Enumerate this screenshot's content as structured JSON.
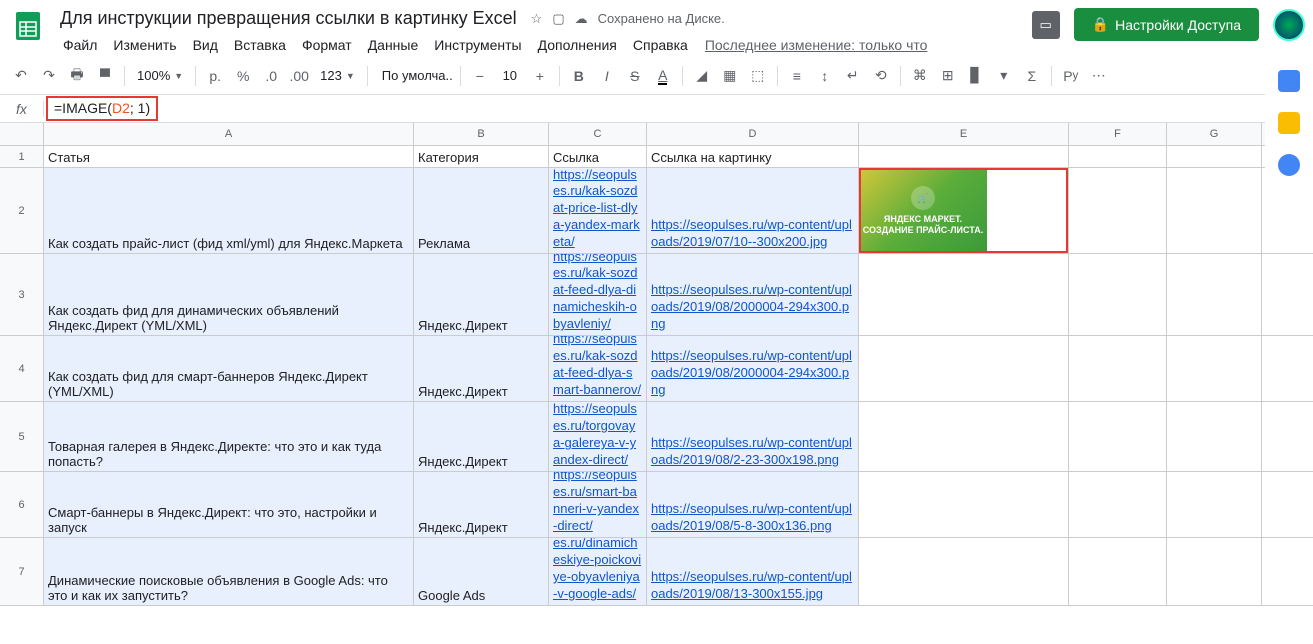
{
  "doc_title": "Для инструкции превращения ссылки в картинку Excel",
  "drive_status": "Сохранено на Диске.",
  "menus": [
    "Файл",
    "Изменить",
    "Вид",
    "Вставка",
    "Формат",
    "Данные",
    "Инструменты",
    "Дополнения",
    "Справка"
  ],
  "last_edit": "Последнее изменение: только что",
  "share_btn": "Настройки Доступа",
  "toolbar": {
    "zoom": "100%",
    "currency": "р.",
    "percent": "%",
    "dec1": ".0",
    "dec2": ".00",
    "fmt": "123",
    "font": "По умолча...",
    "size": "10"
  },
  "formula": {
    "prefix": "=IMAGE(",
    "ref": "D2",
    "suffix": "; 1)"
  },
  "cols": [
    "A",
    "B",
    "C",
    "D",
    "E",
    "F",
    "G"
  ],
  "headers": {
    "a": "Статья",
    "b": "Категория",
    "c": "Ссылка",
    "d": "Ссылка на картинку"
  },
  "rows": [
    {
      "n": "2",
      "a": "Как создать прайс-лист (фид xml/yml) для Яндекс.Маркета",
      "b": "Реклама",
      "c": "https://seopulses.ru/kak-sozdat-price-list-dlya-yandex-marketa/",
      "d": "https://seopulses.ru/wp-content/uploads/2019/07/10--300x200.jpg"
    },
    {
      "n": "3",
      "a": "Как создать фид для динамических объявлений Яндекс.Директ (YML/XML)",
      "b": "Яндекс.Директ",
      "c": "https://seopulses.ru/kak-sozdat-feed-dlya-dinamicheskih-obyavleniy/",
      "d": "https://seopulses.ru/wp-content/uploads/2019/08/2000004-294x300.png"
    },
    {
      "n": "4",
      "a": "Как создать фид для смарт-баннеров Яндекс.Директ (YML/XML)",
      "b": "Яндекс.Директ",
      "c": "https://seopulses.ru/kak-sozdat-feed-dlya-smart-bannerov/",
      "d": "https://seopulses.ru/wp-content/uploads/2019/08/2000004-294x300.png"
    },
    {
      "n": "5",
      "a": "Товарная галерея в Яндекс.Директе: что это и как туда попасть?",
      "b": "Яндекс.Директ",
      "c": "https://seopulses.ru/torgovaya-galereya-v-yandex-direct/",
      "d": "https://seopulses.ru/wp-content/uploads/2019/08/2-23-300x198.png"
    },
    {
      "n": "6",
      "a": "Смарт-баннеры в Яндекс.Директ: что это, настройки и запуск",
      "b": "Яндекс.Директ",
      "c": "https://seopulses.ru/smart-banneri-v-yandex-direct/",
      "d": "https://seopulses.ru/wp-content/uploads/2019/08/5-8-300x136.png"
    },
    {
      "n": "7",
      "a": "Динамические поисковые объявления в Google Ads: что это и как их запустить?",
      "b": "Google Ads",
      "c": "https://seopulses.ru/dinamicheskiye-poickoviye-obyavleniya-v-google-ads/",
      "d": "https://seopulses.ru/wp-content/uploads/2019/08/13-300x155.jpg"
    }
  ],
  "img_text": {
    "l1": "ЯНДЕКС МАРКЕТ.",
    "l2": "СОЗДАНИЕ ПРАЙС-ЛИСТА."
  }
}
